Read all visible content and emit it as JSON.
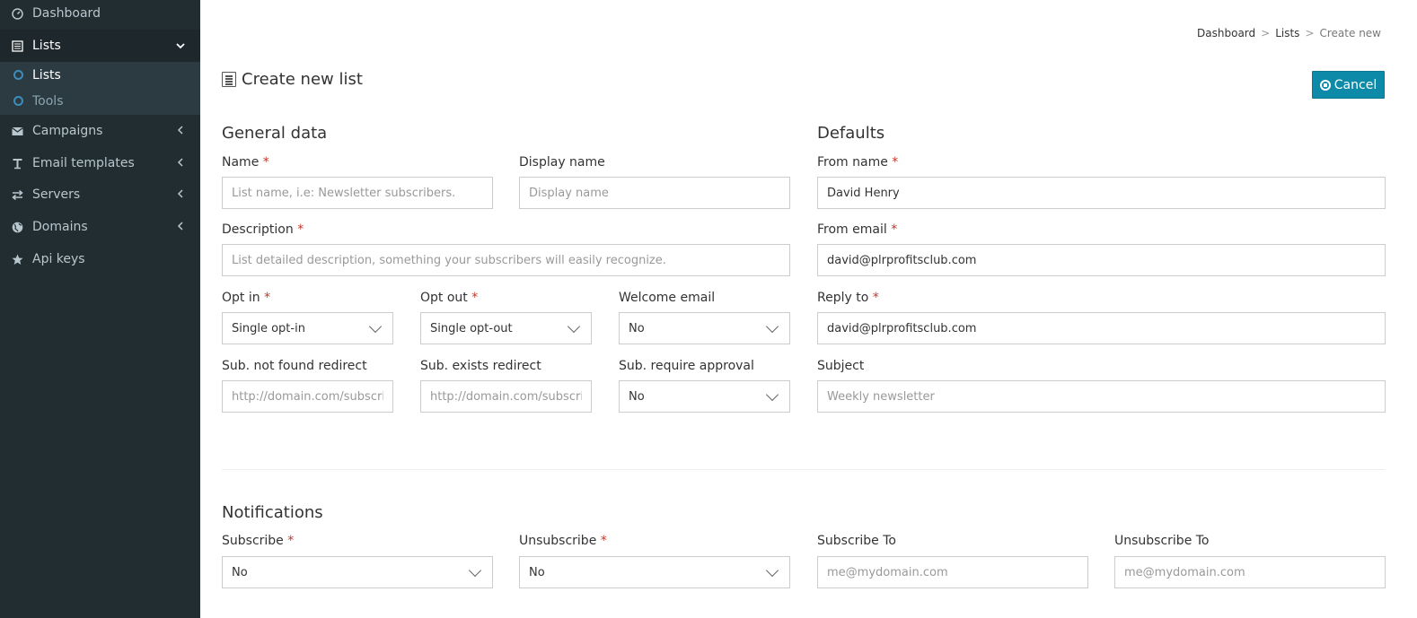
{
  "sidebar": {
    "items": [
      {
        "label": "Dashboard",
        "icon": "dashboard-icon"
      },
      {
        "label": "Lists",
        "icon": "list-icon"
      },
      {
        "label": "Campaigns",
        "icon": "envelope-icon"
      },
      {
        "label": "Email templates",
        "icon": "text-icon"
      },
      {
        "label": "Servers",
        "icon": "exchange-icon"
      },
      {
        "label": "Domains",
        "icon": "globe-icon"
      },
      {
        "label": "Api keys",
        "icon": "star-icon"
      }
    ],
    "subitems": [
      {
        "label": "Lists"
      },
      {
        "label": "Tools"
      }
    ]
  },
  "breadcrumb": {
    "items": [
      "Dashboard",
      "Lists",
      "Create new"
    ],
    "separator": ">"
  },
  "page": {
    "title": "Create new list",
    "cancel_label": "Cancel"
  },
  "general": {
    "title": "General data",
    "name_label": "Name",
    "name_placeholder": "List name, i.e: Newsletter subscribers.",
    "display_name_label": "Display name",
    "display_name_placeholder": "Display name",
    "description_label": "Description",
    "description_placeholder": "List detailed description, something your subscribers will easily recognize.",
    "opt_in_label": "Opt in",
    "opt_in_value": "Single opt-in",
    "opt_out_label": "Opt out",
    "opt_out_value": "Single opt-out",
    "welcome_email_label": "Welcome email",
    "welcome_email_value": "No",
    "sub_not_found_label": "Sub. not found redirect",
    "sub_not_found_placeholder": "http://domain.com/subscriber-not-found",
    "sub_exists_label": "Sub. exists redirect",
    "sub_exists_placeholder": "http://domain.com/subscriber-exists",
    "sub_require_approval_label": "Sub. require approval",
    "sub_require_approval_value": "No",
    "required_mark": "*"
  },
  "defaults": {
    "title": "Defaults",
    "from_name_label": "From name",
    "from_name_value": "David Henry",
    "from_email_label": "From email",
    "from_email_value": "david@plrprofitsclub.com",
    "reply_to_label": "Reply to",
    "reply_to_value": "david@plrprofitsclub.com",
    "subject_label": "Subject",
    "subject_placeholder": "Weekly newsletter"
  },
  "notifications": {
    "title": "Notifications",
    "subscribe_label": "Subscribe",
    "subscribe_value": "No",
    "unsubscribe_label": "Unsubscribe",
    "unsubscribe_value": "No",
    "subscribe_to_label": "Subscribe To",
    "subscribe_to_placeholder": "me@mydomain.com",
    "unsubscribe_to_label": "Unsubscribe To",
    "unsubscribe_to_placeholder": "me@mydomain.com"
  },
  "colors": {
    "sidebar_bg": "#222d32",
    "accent": "#0c8aa8",
    "required": "#c0392b"
  }
}
